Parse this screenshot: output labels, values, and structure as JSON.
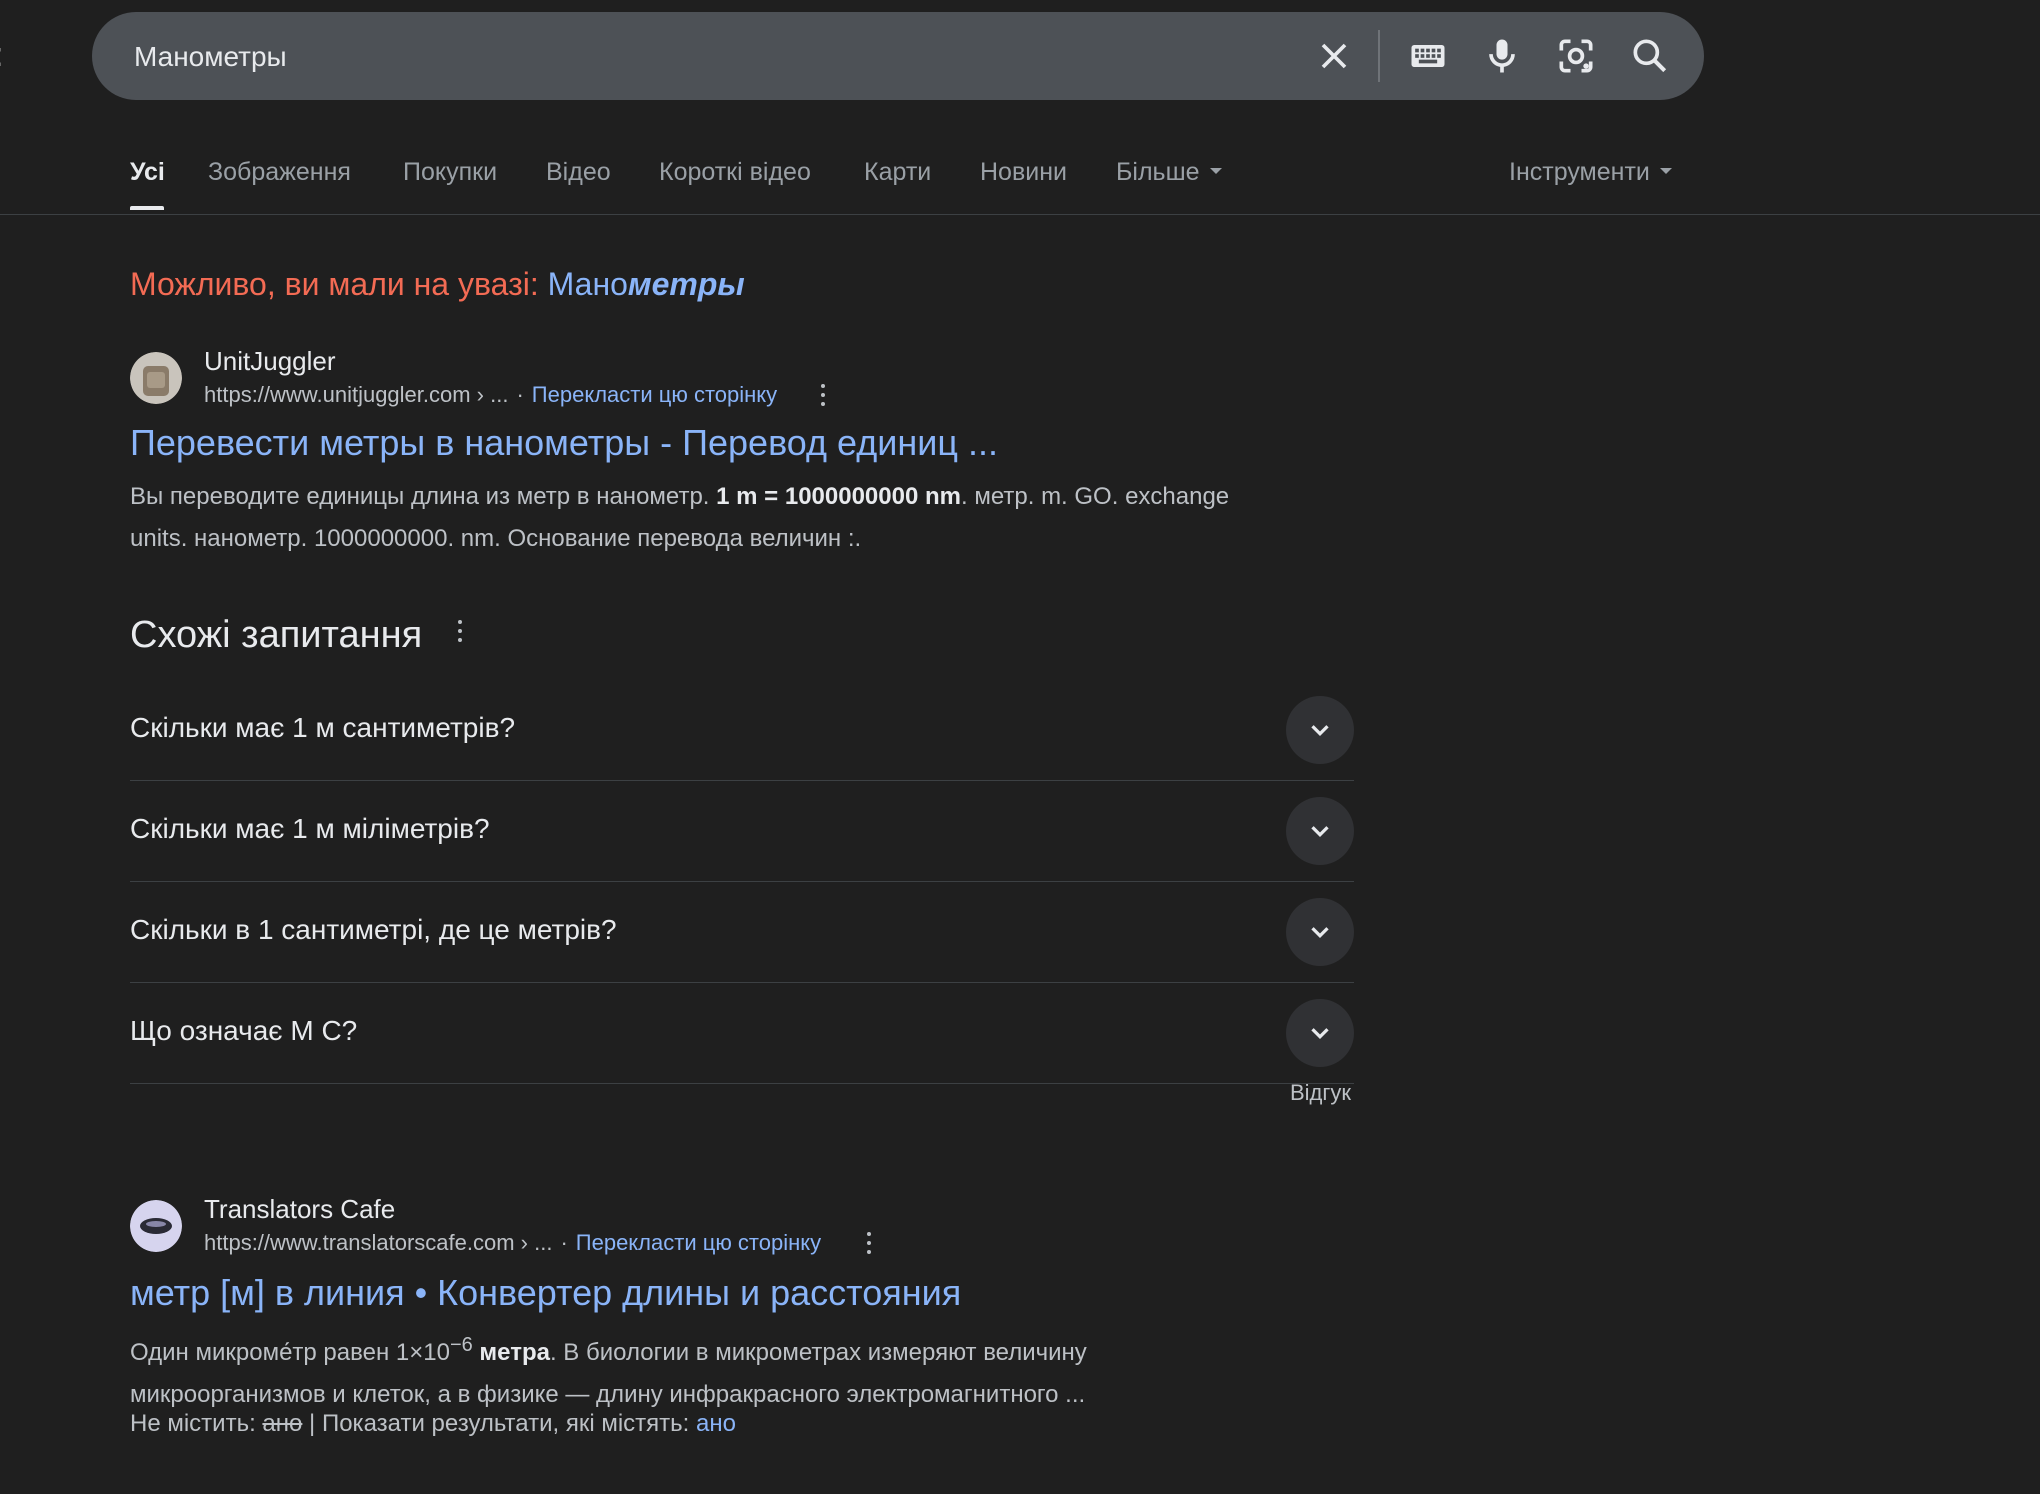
{
  "edge_glyph": ":",
  "search": {
    "value": "Манометры"
  },
  "search_icons": [
    "close-icon",
    "keyboard-icon",
    "microphone-icon",
    "lens-icon",
    "search-icon"
  ],
  "tabs": [
    {
      "label": "Усі",
      "active": true
    },
    {
      "label": "Зображення"
    },
    {
      "label": "Покупки"
    },
    {
      "label": "Відео"
    },
    {
      "label": "Короткі відео"
    },
    {
      "label": "Карти"
    },
    {
      "label": "Новини"
    },
    {
      "label": "Більше"
    }
  ],
  "tools_label": "Інструменти",
  "did_you_mean": {
    "lead": "Можливо, ви мали на увазі:",
    "base": "Мано",
    "emphasis": "метры"
  },
  "results": [
    {
      "site": "UnitJuggler",
      "url": "https://www.unitjuggler.com › ...",
      "translate": "Перекласти цю сторінку",
      "title": "Перевести метры в нанометры - Перевод единиц ...",
      "snippet": {
        "l1_a": "Вы переводите единицы длина из метр в нанометр. ",
        "l1_b": "1 m = 1000000000 nm",
        "l1_c": ". метр. m. GO. exchange",
        "l2": "units. нанометр. 1000000000. nm. Основание перевода величин :."
      }
    },
    {
      "site": "Translators Cafe",
      "url": "https://www.translatorscafe.com › ...",
      "translate": "Перекласти цю сторінку",
      "title": "метр [м] в линия • Конвертер длины и расстояния",
      "snippet": {
        "l1_a": "Один микроме́тр равен 1×10",
        "l1_sup": "−6",
        "l1_b": " метра",
        "l1_c": ". В биологии в микрометрах измеряют величину",
        "l2": "микроорганизмов и клеток, а в физике — длину инфракрасного электромагнитного ..."
      },
      "missing_label": "Не містить:",
      "missing_word": "ано",
      "show_label": "| Показати результати, які містять:",
      "show_word": "ано"
    }
  ],
  "paa": {
    "heading": "Схожі запитання",
    "questions": [
      "Скільки має 1 м сантиметрів?",
      "Скільки має 1 м міліметрів?",
      "Скільки в 1 сантиметрі, де це метрів?",
      "Що означає М С?"
    ]
  },
  "feedback": "Відгук",
  "colors": {
    "background": "#1f1f1f",
    "link": "#8ab4f8",
    "did_you_mean": "#f36b54",
    "searchbar": "#4d5156"
  }
}
